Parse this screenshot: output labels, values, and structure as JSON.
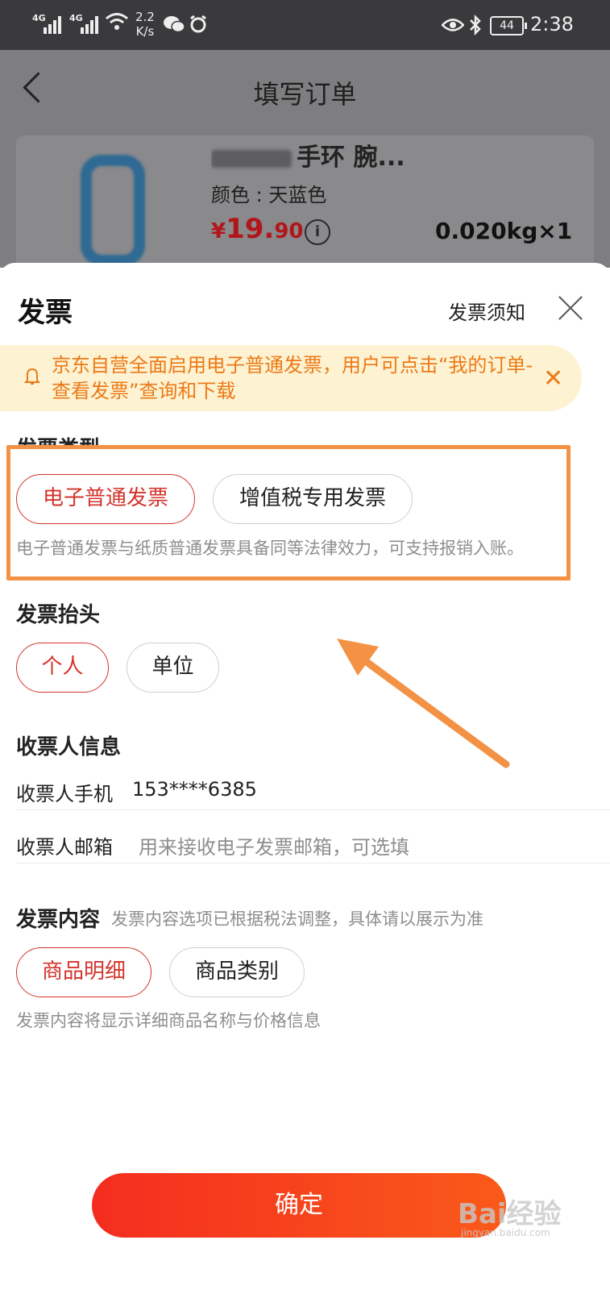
{
  "status_bar": {
    "net1": "4G",
    "net2": "4G",
    "speed_value": "2.2",
    "speed_unit": "K/s",
    "battery": "44",
    "time": "2:38"
  },
  "order_page": {
    "title": "填写订单",
    "product_name_visible": "手环 腕...",
    "color": "颜色 : 天蓝色",
    "price_symbol": "¥",
    "price_main": "19.",
    "price_decimal": "90",
    "weight_qty": "0.020kg×1"
  },
  "sheet": {
    "title": "发票",
    "notice_link": "发票须知",
    "banner_text": "京东自营全面启用电子普通发票，用户可点击“我的订单-查看发票”查询和下载",
    "invoice_type": {
      "heading": "发票类型",
      "options": [
        "电子普通发票",
        "增值税专用发票"
      ],
      "selected_index": 0,
      "hint": "电子普通发票与纸质普通发票具备同等法律效力，可支持报销入账。"
    },
    "invoice_header": {
      "heading": "发票抬头",
      "options": [
        "个人",
        "单位"
      ],
      "selected_index": 0
    },
    "recipient": {
      "heading": "收票人信息",
      "phone_label": "收票人手机",
      "phone_value": "153****6385",
      "email_label": "收票人邮箱",
      "email_placeholder": "用来接收电子发票邮箱，可选填"
    },
    "content": {
      "heading": "发票内容",
      "subheading": "发票内容选项已根据税法调整，具体请以展示为准",
      "options": [
        "商品明细",
        "商品类别"
      ],
      "selected_index": 0,
      "hint": "发票内容将显示详细商品名称与价格信息"
    },
    "confirm_label": "确定"
  },
  "watermark": {
    "text": "Bai经验",
    "sub": "jingyan.baidu.com"
  },
  "colors": {
    "accent_red": "#d3342c",
    "highlight_orange": "#f39245",
    "banner_orange": "#ec7a17"
  }
}
